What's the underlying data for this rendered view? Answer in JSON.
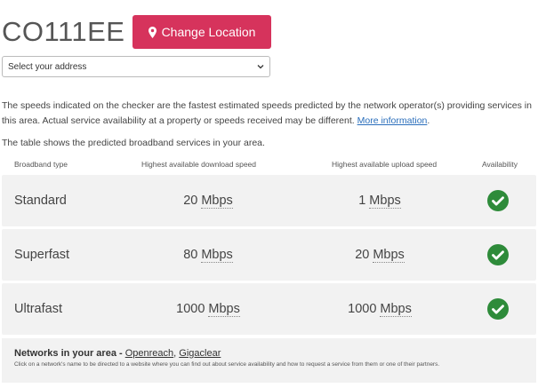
{
  "header": {
    "postcode": "CO111EE",
    "change_location_label": "Change Location"
  },
  "address_select": {
    "value": "Select your address"
  },
  "intro": {
    "text": "The speeds indicated on the checker are the fastest estimated speeds predicted by the network operator(s) providing services in this area. Actual service availability at a property or speeds received may be different.",
    "more_info_link": "More information",
    "period": "."
  },
  "table": {
    "intro": "The table shows the predicted broadband services in your area.",
    "headers": {
      "type": "Broadband type",
      "download": "Highest available download speed",
      "upload": "Highest available upload speed",
      "availability": "Availability"
    },
    "rows": [
      {
        "type": "Standard",
        "download_value": "20",
        "download_unit": "Mbps",
        "upload_value": "1",
        "upload_unit": "Mbps",
        "available": "yes"
      },
      {
        "type": "Superfast",
        "download_value": "80",
        "download_unit": "Mbps",
        "upload_value": "20",
        "upload_unit": "Mbps",
        "available": "yes"
      },
      {
        "type": "Ultrafast",
        "download_value": "1000",
        "download_unit": "Mbps",
        "upload_value": "1000",
        "upload_unit": "Mbps",
        "available": "yes"
      }
    ]
  },
  "networks": {
    "label": "Networks in your area - ",
    "items": [
      "Openreach",
      "Gigaclear"
    ],
    "separator": ", ",
    "help_text": "Click on a network's name to be directed to a website where you can find out about service availability and how to request a service from them or one of their partners."
  },
  "colors": {
    "accent": "#d6335c",
    "check": "#2e8b3a",
    "link": "#2a6ebb",
    "row_bg": "#f2f2f2"
  },
  "icons": {
    "change_location": "map-pin-icon",
    "select": "chevron-down-icon",
    "available": "check-circle-icon"
  }
}
